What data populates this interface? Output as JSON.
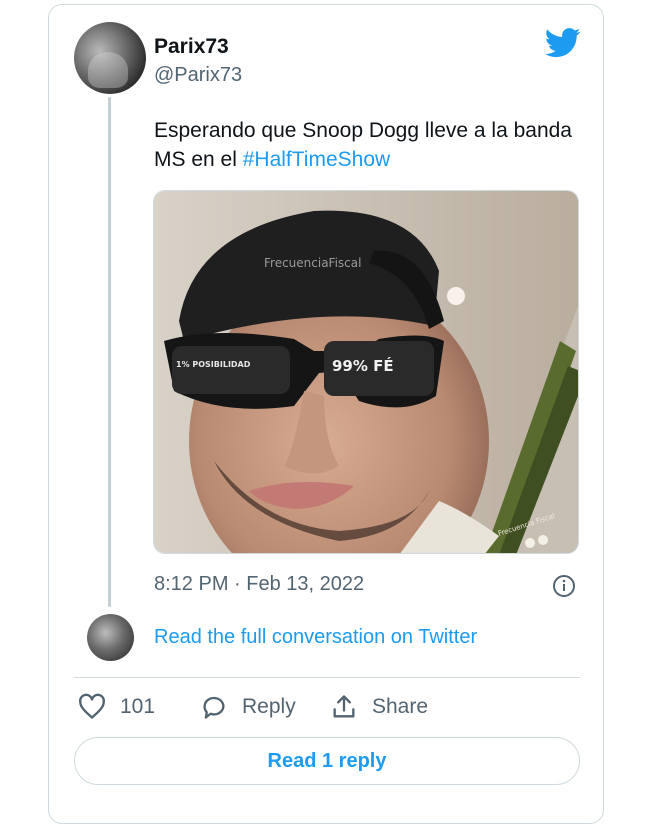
{
  "tweet": {
    "display_name": "Parix73",
    "handle": "@Parix73",
    "text_plain": "Esperando que Snoop Dogg lleve a la banda MS en el ",
    "hashtag": "#HalfTimeShow",
    "timestamp": "8:12 PM · Feb 13, 2022",
    "media": {
      "watermark": "FrecuenciaFiscal",
      "lens_left_text": "1% POSIBILIDAD",
      "lens_right_text": "99% FÉ",
      "corner_watermark": "Frecuencia Fiscal"
    }
  },
  "read_full_label": "Read the full conversation on Twitter",
  "actions": {
    "like_count": "101",
    "reply_label": "Reply",
    "share_label": "Share"
  },
  "read_reply_label": "Read 1 reply",
  "colors": {
    "accent": "#1d9bf0",
    "text": "#0f1419",
    "muted": "#536471",
    "border": "#cfd9de"
  },
  "icons": [
    "twitter-bird-icon",
    "info-icon",
    "heart-icon",
    "reply-bubble-icon",
    "share-icon"
  ]
}
